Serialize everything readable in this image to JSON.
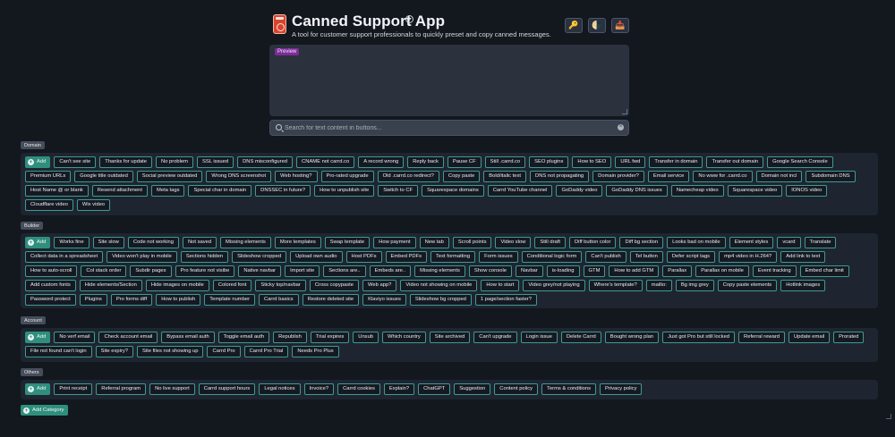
{
  "header": {
    "title": "Canned Support App",
    "subtitle": "A tool for customer support professionals to quickly preset and copy canned messages.",
    "info_icon": "info-icon",
    "actions": [
      {
        "icon": "key-icon",
        "glyph": "🔑"
      },
      {
        "icon": "moon-icon",
        "glyph": "🌗"
      },
      {
        "icon": "inbox-tray-icon",
        "glyph": "📥"
      }
    ]
  },
  "preview": {
    "tag": "Preview",
    "value": ""
  },
  "search": {
    "placeholder": "Search for text content in buttons...",
    "value": ""
  },
  "add_label": "Add",
  "add_category_label": "Add Category",
  "sections": [
    {
      "label": "Domain",
      "buttons": [
        "Can't see site",
        "Thanks for update",
        "No problem",
        "SSL issued",
        "DNS misconfigured",
        "CNAME not carrd.co",
        "A record wrong",
        "Reply back",
        "Pause CF",
        "Still .carrd.co",
        "SEO plugins",
        "How to SEO",
        "URL fwd",
        "Transfer in domain",
        "Transfer out domain",
        "Google Search Console",
        "Premium URLs",
        "Google title outdated",
        "Social preview outdated",
        "Wrong DNS screenshot",
        "Web hosting?",
        "Pro-rated upgrade",
        "Old .carrd.co redirect?",
        "Copy paste",
        "Bold/italic text",
        "DNS not propagating",
        "Domain provider?",
        "Email service",
        "No www for .carrd.co",
        "Domain not incl",
        "Subdomain DNS",
        "Host Name @ or blank",
        "Resend attachment",
        "Meta tags",
        "Special char in domain",
        "DNSSEC in future?",
        "How to unpublish site",
        "Switch to CF",
        "Squarespace domains",
        "Carrd YouTube channel",
        "GoDaddy video",
        "GoDaddy DNS issues",
        "Namecheap video",
        "Squarespace video",
        "IONOS video",
        "Cloudflare video",
        "Wix video"
      ]
    },
    {
      "label": "Builder",
      "buttons": [
        "Works fine",
        "Site slow",
        "Code not working",
        "Not saved",
        "Missing elements",
        "More templates",
        "Swap template",
        "How payment",
        "New tab",
        "Scroll points",
        "Video slow",
        "Still draft",
        "Diff button color",
        "Diff bg section",
        "Looks bad on mobile",
        "Element styles",
        "vcard",
        "Translate",
        "Collect data in a spreadsheet",
        "Video won't play in mobile",
        "Sections hidden",
        "Slideshow cropped",
        "Upload own audio",
        "Host PDFs",
        "Embed PDFs",
        "Text formatting",
        "Form issues",
        "Conditional logic form",
        "Can't publish",
        "Tel button",
        "Defer script tags",
        "mp4 video in H.264?",
        "Add link to text",
        "How to auto-scroll",
        "Col stack order",
        "Subdir pages",
        "Pro feature not visibe",
        "Native navbar",
        "Import site",
        "Sections are..",
        "Embeds are..",
        "Missing elements",
        "Show console",
        "Navbar",
        "is-loading",
        "GTM",
        "How to add GTM",
        "Parallax",
        "Parallax on mobile",
        "Event tracking",
        "Embed char limit",
        "Add custom fonts",
        "Hide elements/Section",
        "Hide images on mobile",
        "Colored font",
        "Sticky top/navbar",
        "Cross copypaste",
        "Web app?",
        "Video not showing on mobile",
        "How to start",
        "Video grey/not playing",
        "Where's template?",
        "mailto:",
        "Bg img grey",
        "Copy paste elements",
        "Hotlink images",
        "Password protect",
        "Plugins",
        "Pro forms diff",
        "How to publish",
        "Template number",
        "Carrd basics",
        "Restore deleted site",
        "Klaviyo issues",
        "Slideshow bg cropped",
        "1 page/section faster?"
      ]
    },
    {
      "label": "Account",
      "buttons": [
        "No verf email",
        "Check account email",
        "Bypass email auth",
        "Toggle email auth",
        "Republish",
        "Trial expires",
        "Unsub",
        "Which country",
        "Site archived",
        "Can't upgrade",
        "Login issue",
        "Delete Carrd",
        "Bought wrong plan",
        "Just got Pro but still locked",
        "Referral reward",
        "Update email",
        "Prorated",
        "File not found can't login",
        "Site expiry?",
        "Site files not showing up",
        "Carrd Pro",
        "Carrd Pro Trial",
        "Needs Pro Plus"
      ]
    },
    {
      "label": "Others",
      "buttons": [
        "Print receipt",
        "Referral program",
        "No live support",
        "Carrd support hours",
        "Legal notices",
        "Invoice?",
        "Carrd cookies",
        "Explain?",
        "ChatGPT",
        "Suggestion",
        "Content policy",
        "Terms & conditions",
        "Privacy policy"
      ]
    }
  ]
}
